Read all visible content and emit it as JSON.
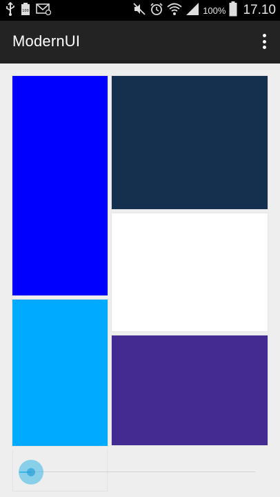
{
  "status_bar": {
    "battery_percent": "100%",
    "time": "17.10",
    "icons": [
      "usb-icon",
      "battery-full-icon",
      "mail-icon",
      "mute-icon",
      "alarm-icon",
      "wifi-icon",
      "signal-icon",
      "battery-icon"
    ]
  },
  "action_bar": {
    "title": "ModernUI",
    "overflow_icon": "more-vert-icon"
  },
  "tiles": [
    {
      "name": "blue",
      "color": "#0000ff"
    },
    {
      "name": "navy",
      "color": "#15304f"
    },
    {
      "name": "white",
      "color": "#ffffff"
    },
    {
      "name": "light-blue",
      "color": "#00aaff"
    },
    {
      "name": "purple",
      "color": "#432b92"
    }
  ],
  "slider": {
    "value_fraction": 0.05,
    "accent_color": "#39b7e6"
  }
}
